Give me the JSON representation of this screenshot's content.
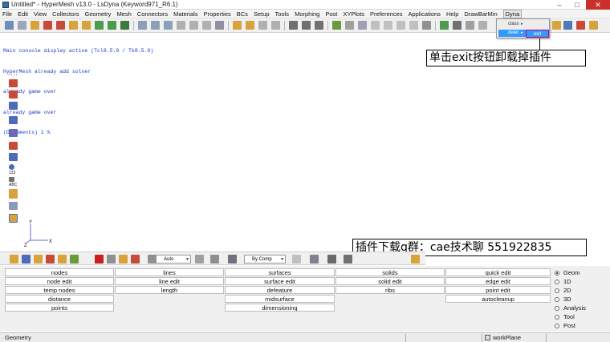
{
  "window": {
    "title": "Untitled* - HyperMesh v13.0 - LsDyna (Keyword971_R6.1)",
    "minimize_glyph": "–",
    "maximize_glyph": "□",
    "close_glyph": "✕"
  },
  "menu": {
    "items": [
      "File",
      "Edit",
      "View",
      "Collectors",
      "Geometry",
      "Mesh",
      "Connectors",
      "Materials",
      "Properties",
      "BCs",
      "Setup",
      "Tools",
      "Morphing",
      "Post",
      "XYPlots",
      "Preferences",
      "Applications",
      "Help",
      "DrawBarMin",
      "Dyna"
    ],
    "active": "Dyna"
  },
  "dyna_menu": {
    "class_label": "class",
    "delet_label": "delet",
    "exit_label": "exit",
    "submenu_glyph": "▸"
  },
  "console": {
    "lines": [
      "Main console display active (Tcl8.5.9 / Tk8.5.9)",
      "HyperMesh already add solver",
      "already game over",
      "already game over",
      "(Documents) 1 %"
    ],
    "dots": "...."
  },
  "annotations": {
    "exit_hint": "单击exit按钮卸载掉插件",
    "download_hint": "插件下载q群：cae技术聊 551922835"
  },
  "left_toolbar": {
    "label_123": "123",
    "label_abc": "ABC"
  },
  "axes": {
    "y_label": "Y",
    "x_label": "X",
    "z_label": "Z"
  },
  "bottom_toolbar": {
    "auto_select": "Auto",
    "comp_select": "By Comp"
  },
  "panel": {
    "columns": [
      [
        "nodes",
        "node edit",
        "temp nodes",
        "distance",
        "points"
      ],
      [
        "lines",
        "line edit",
        "length"
      ],
      [
        "surfaces",
        "surface edit",
        "defeature",
        "midsurface",
        "dimensioning"
      ],
      [
        "solids",
        "solid edit",
        "ribs"
      ],
      [
        "quick edit",
        "edge edit",
        "point edit",
        "autocleanup"
      ]
    ],
    "radios": [
      "Geom",
      "1D",
      "2D",
      "3D",
      "Analysis",
      "Tool",
      "Post"
    ],
    "selected_radio": "Geom"
  },
  "statusbar": {
    "left": "Geometry",
    "workplane": "workPlane"
  },
  "colors": {
    "console_text": "#1a3cc7",
    "menu_highlight": "#3399ff",
    "exit_border": "#c0007a"
  }
}
